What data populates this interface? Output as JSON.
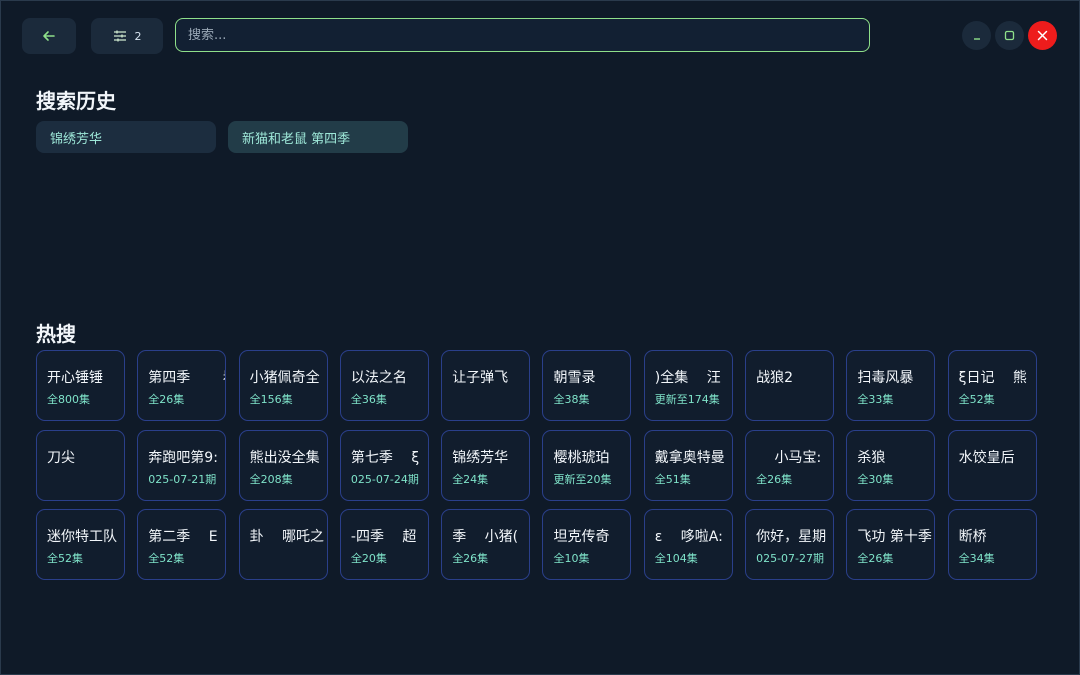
{
  "toolbar": {
    "back_icon": "arrow-left-icon",
    "filter_icon": "sliders-icon",
    "filter_count": "2"
  },
  "search": {
    "placeholder": "搜索...",
    "value": ""
  },
  "window": {
    "minimize_icon": "minimize-icon",
    "maximize_icon": "maximize-icon",
    "close_icon": "close-icon",
    "close_color": "#ee1c1c"
  },
  "history": {
    "title": "搜索历史",
    "items": [
      "锦绣芳华",
      "新猫和老鼠 第四季"
    ]
  },
  "hot": {
    "title": "热搜",
    "items": [
      {
        "title": "开心锤锤",
        "sub": "全800集"
      },
      {
        "title": "第四季　　 看",
        "sub": "全26集"
      },
      {
        "title": "小猪佩奇全",
        "sub": "全156集"
      },
      {
        "title": "以法之名",
        "sub": "全36集"
      },
      {
        "title": "让子弹飞",
        "sub": ""
      },
      {
        "title": "朝雪录",
        "sub": "全38集"
      },
      {
        "title": ")全集　 汪",
        "sub": "更新至174集"
      },
      {
        "title": "战狼2",
        "sub": ""
      },
      {
        "title": "扫毒风暴",
        "sub": "全33集"
      },
      {
        "title": "ξ日记　 熊",
        "sub": "全52集"
      },
      {
        "title": "刀尖",
        "sub": ""
      },
      {
        "title": "奔跑吧第9:",
        "sub": "025-07-21期"
      },
      {
        "title": "熊出没全集",
        "sub": "全208集"
      },
      {
        "title": "第七季　 ξ",
        "sub": "025-07-24期"
      },
      {
        "title": "锦绣芳华",
        "sub": "全24集"
      },
      {
        "title": "樱桃琥珀",
        "sub": "更新至20集"
      },
      {
        "title": "戴拿奥特曼",
        "sub": "全51集"
      },
      {
        "title": "　 小马宝:",
        "sub": "全26集"
      },
      {
        "title": "杀狼",
        "sub": "全30集"
      },
      {
        "title": "水饺皇后",
        "sub": ""
      },
      {
        "title": "迷你特工队",
        "sub": "全52集"
      },
      {
        "title": "第二季　 E",
        "sub": "全52集"
      },
      {
        "title": "卦　 哪吒之",
        "sub": ""
      },
      {
        "title": "-四季　 超",
        "sub": "全20集"
      },
      {
        "title": "季　 小猪(",
        "sub": "全26集"
      },
      {
        "title": "坦克传奇",
        "sub": "全10集"
      },
      {
        "title": "ε　 哆啦A:",
        "sub": "全104集"
      },
      {
        "title": "你好，星期",
        "sub": "025-07-27期"
      },
      {
        "title": "飞功 第十季",
        "sub": "全26集"
      },
      {
        "title": "断桥",
        "sub": "全34集"
      }
    ]
  }
}
